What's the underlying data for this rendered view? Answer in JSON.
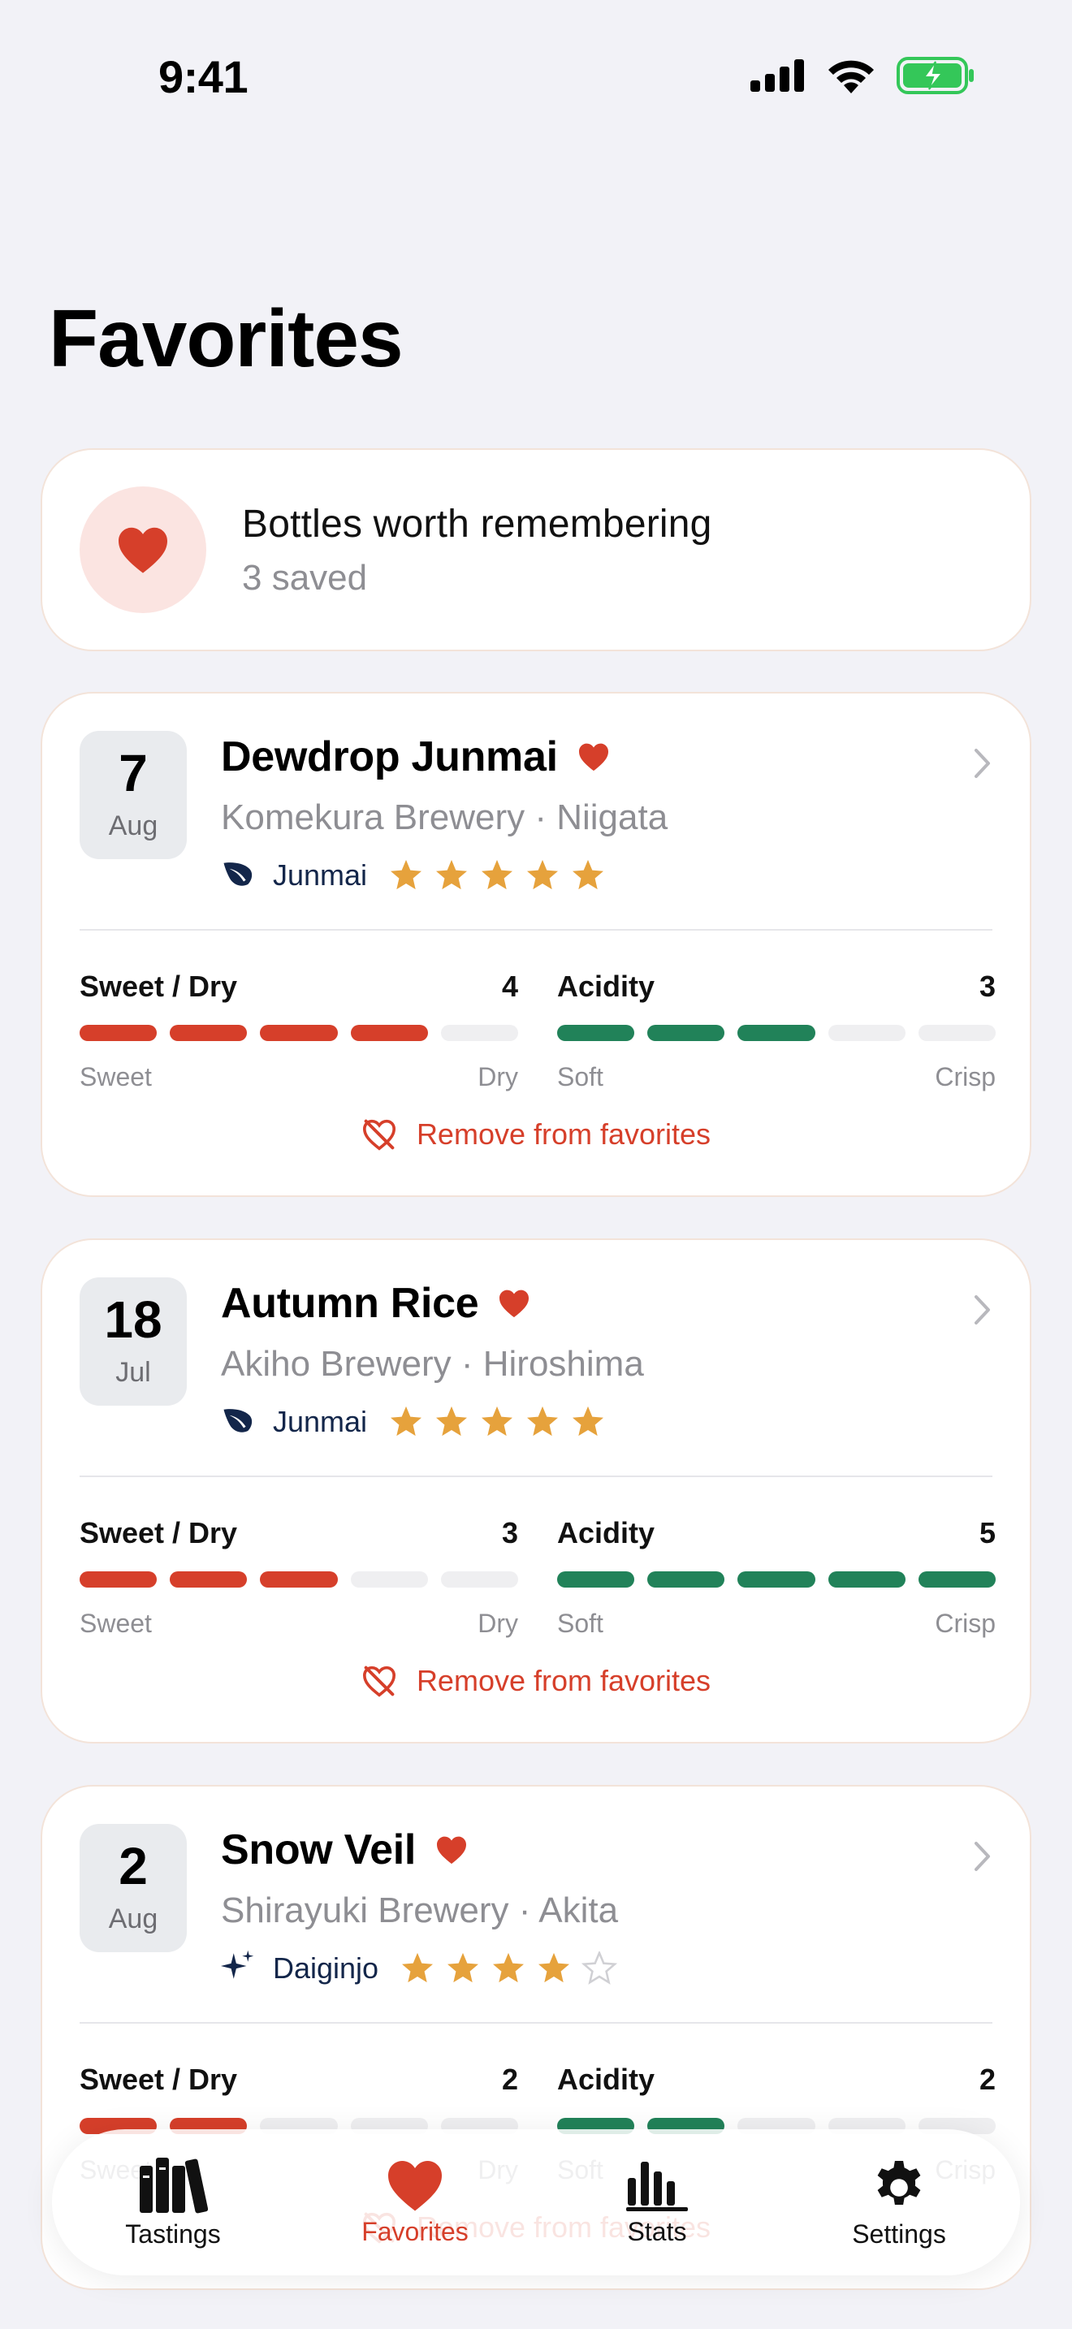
{
  "status_bar": {
    "time": "9:41"
  },
  "page": {
    "title": "Favorites"
  },
  "summary": {
    "title": "Bottles worth remembering",
    "count": "3 saved"
  },
  "colors": {
    "accent_red": "#d63f2a",
    "acidity_green": "#218259",
    "star_gold": "#e6a23c",
    "style_navy": "#13264a"
  },
  "favorites": [
    {
      "day": "7",
      "month": "Aug",
      "name": "Dewdrop Junmai",
      "brewery": "Komekura Brewery · Niigata",
      "style": "Junmai",
      "style_icon": "leaf-icon",
      "rating": 5,
      "sweet_dry": {
        "label": "Sweet / Dry",
        "value": "4",
        "level": 4,
        "min_label": "Sweet",
        "max_label": "Dry"
      },
      "acidity": {
        "label": "Acidity",
        "value": "3",
        "level": 3,
        "min_label": "Soft",
        "max_label": "Crisp"
      },
      "remove_label": "Remove from favorites"
    },
    {
      "day": "18",
      "month": "Jul",
      "name": "Autumn Rice",
      "brewery": "Akiho Brewery · Hiroshima",
      "style": "Junmai",
      "style_icon": "leaf-icon",
      "rating": 5,
      "sweet_dry": {
        "label": "Sweet / Dry",
        "value": "3",
        "level": 3,
        "min_label": "Sweet",
        "max_label": "Dry"
      },
      "acidity": {
        "label": "Acidity",
        "value": "5",
        "level": 5,
        "min_label": "Soft",
        "max_label": "Crisp"
      },
      "remove_label": "Remove from favorites"
    },
    {
      "day": "2",
      "month": "Aug",
      "name": "Snow Veil",
      "brewery": "Shirayuki Brewery · Akita",
      "style": "Daiginjo",
      "style_icon": "sparkle-icon",
      "rating": 4,
      "sweet_dry": {
        "label": "Sweet / Dry",
        "value": "2",
        "level": 2,
        "min_label": "Sweet",
        "max_label": "Dry"
      },
      "acidity": {
        "label": "Acidity",
        "value": "2",
        "level": 2,
        "min_label": "Soft",
        "max_label": "Crisp"
      },
      "remove_label": "Remove from favorites"
    }
  ],
  "tabs": [
    {
      "label": "Tastings",
      "icon": "books-icon"
    },
    {
      "label": "Favorites",
      "icon": "heart-icon",
      "active": true
    },
    {
      "label": "Stats",
      "icon": "bar-chart-icon"
    },
    {
      "label": "Settings",
      "icon": "gear-icon"
    }
  ]
}
